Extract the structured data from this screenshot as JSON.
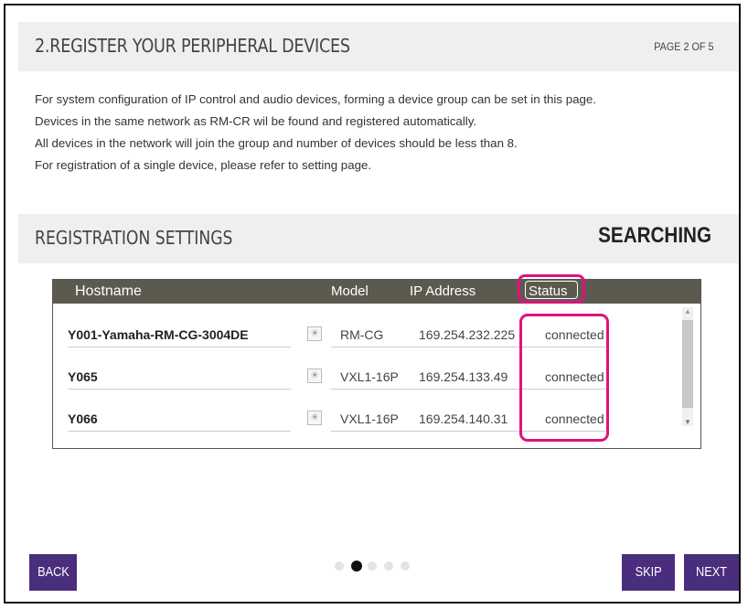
{
  "header": {
    "title": "2.REGISTER YOUR PERIPHERAL DEVICES",
    "page_indicator": "PAGE 2 OF 5"
  },
  "intro": {
    "lines": [
      "For system configuration of IP control and audio devices, forming a device group can be set in this page.",
      "Devices in the same network as RM-CR wil be found and registered automatically.",
      "All devices in the network will join the group and number of devices should be less than 8.",
      "For registration of a single device, please refer to setting page."
    ]
  },
  "settings": {
    "title": "REGISTRATION SETTINGS",
    "status": "SEARCHING"
  },
  "table": {
    "columns": {
      "hostname": "Hostname",
      "model": "Model",
      "ip": "IP Address",
      "status": "Status"
    },
    "rows": [
      {
        "hostname": "Y001-Yamaha-RM-CG-3004DE",
        "model": "RM-CG",
        "ip": "169.254.232.225",
        "status": "connected"
      },
      {
        "hostname": "Y065",
        "model": "VXL1-16P",
        "ip": "169.254.133.49",
        "status": "connected"
      },
      {
        "hostname": "Y066",
        "model": "VXL1-16P",
        "ip": "169.254.140.31",
        "status": "connected"
      }
    ],
    "identify_icon": "sun-icon"
  },
  "pagination": {
    "total": 5,
    "active": 2
  },
  "buttons": {
    "back": "BACK",
    "skip": "SKIP",
    "next": "NEXT"
  },
  "colors": {
    "accent_button": "#4a2d7c",
    "highlight": "#e0127e",
    "table_header": "#5c5a4e"
  }
}
